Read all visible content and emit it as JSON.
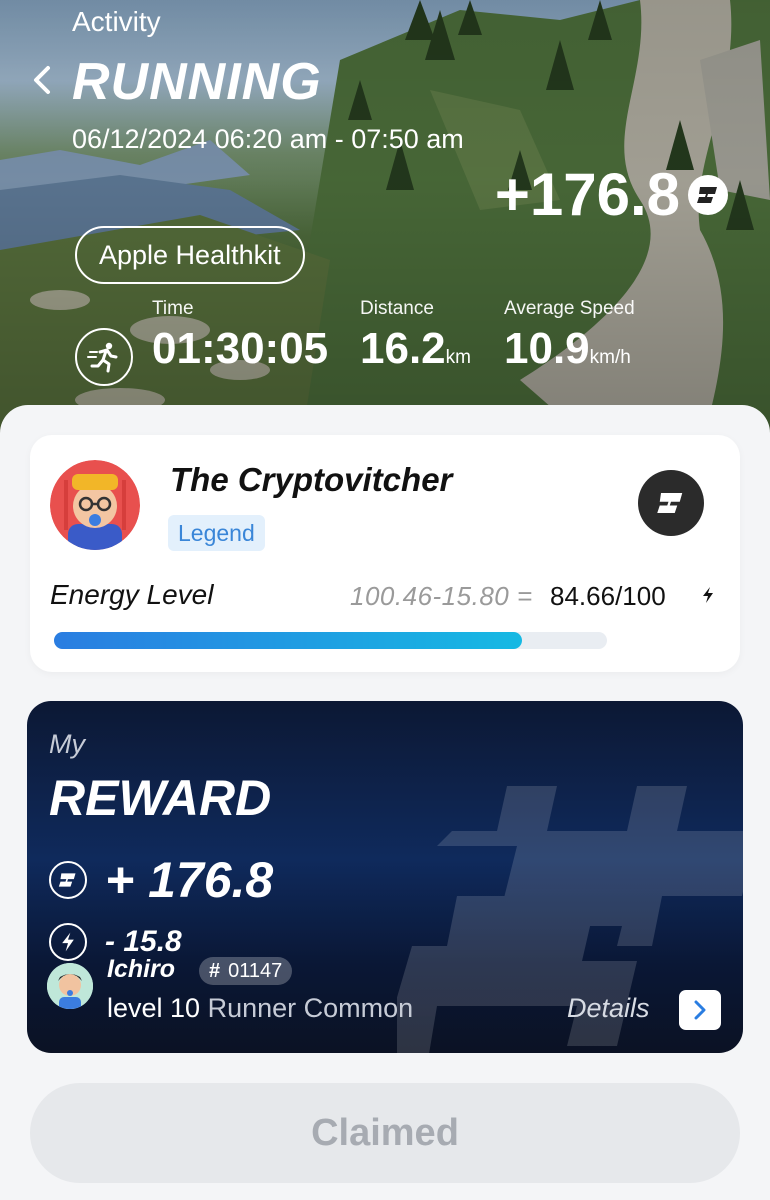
{
  "header": {
    "subtitle": "Activity",
    "title": "RUNNING",
    "date_range": "06/12/2024 06:20 am - 07:50 am",
    "earned": "+176.8",
    "source": "Apple Healthkit"
  },
  "stats": {
    "time": {
      "label": "Time",
      "value": "01:30:05"
    },
    "distance": {
      "label": "Distance",
      "value": "16.2",
      "unit": "km"
    },
    "speed": {
      "label": "Average Speed",
      "value": "10.9",
      "unit": "km/h"
    }
  },
  "profile": {
    "username": "The Cryptovitcher",
    "tier": "Legend",
    "energy_label": "Energy Level",
    "energy_calc": "100.46-15.80 =",
    "energy_total": "84.66/100",
    "energy_fraction": 0.8466
  },
  "reward": {
    "my": "My",
    "title": "REWARD",
    "earned": "+ 176.8",
    "energy_cost": "- 15.8",
    "runner_name": "Ichiro",
    "runner_id_hash": "#",
    "runner_id": "01147",
    "runner_level": "level 10",
    "runner_class": "Runner Common",
    "details": "Details"
  },
  "actions": {
    "claimed": "Claimed"
  },
  "colors": {
    "accent_blue": "#2a7de1",
    "accent_cyan": "#16b9e3",
    "tier_bg": "#e3f0fc",
    "tier_text": "#3a86d8",
    "reward_bg": "#0f2a5c"
  },
  "icons": [
    "back-chevron-icon",
    "token-coin-icon",
    "running-person-icon",
    "lightning-bolt-icon",
    "chevron-right-icon"
  ]
}
